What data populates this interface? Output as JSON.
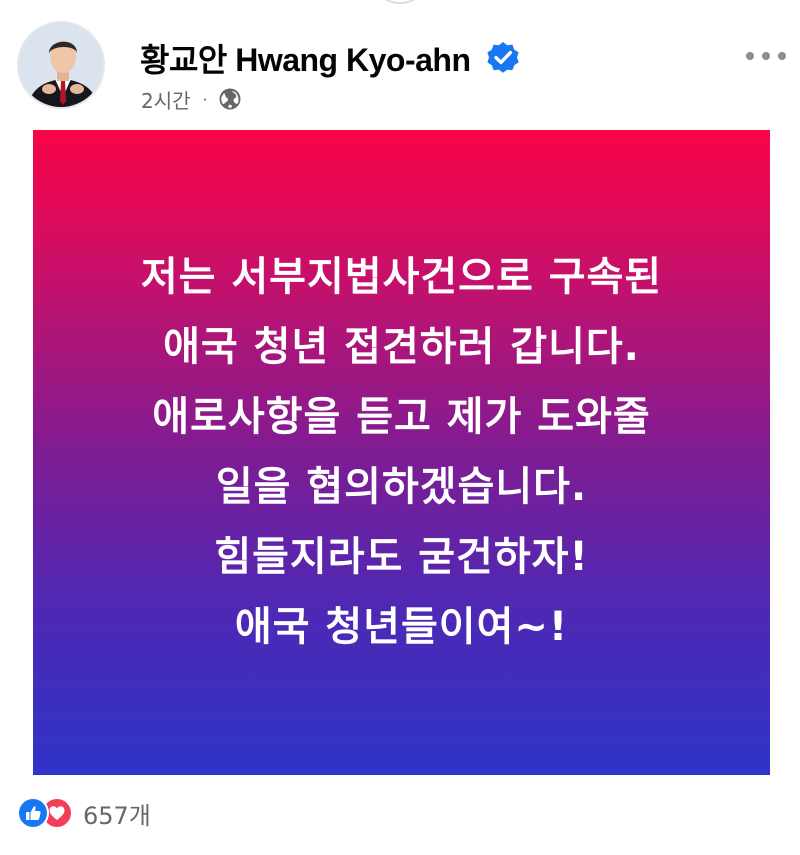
{
  "post": {
    "author_name": "황교안 Hwang Kyo-ahn",
    "verified_icon": "verified-badge-icon",
    "timestamp": "2시간",
    "separator": "·",
    "privacy_icon": "globe-icon",
    "more_icon": "more-options-icon",
    "text_lines": [
      "저는 서부지법사건으로 구속된",
      "애국 청년 접견하러 갑니다.",
      "애로사항을 듣고 제가 도와줄",
      "일을 협의하겠습니다.",
      "힘들지라도 굳건하자!",
      "애국 청년들이여~!"
    ],
    "background_colors": {
      "top": "#f70546",
      "middle": "#7a1d96",
      "bottom": "#2f34c8"
    }
  },
  "reactions": {
    "icons": [
      "like-icon",
      "love-icon"
    ],
    "count_text": "657개",
    "colors": {
      "like": "#1877f2",
      "love": "#f33e58"
    }
  },
  "colors": {
    "secondary_text": "#65676b",
    "verified": "#1877f2"
  }
}
